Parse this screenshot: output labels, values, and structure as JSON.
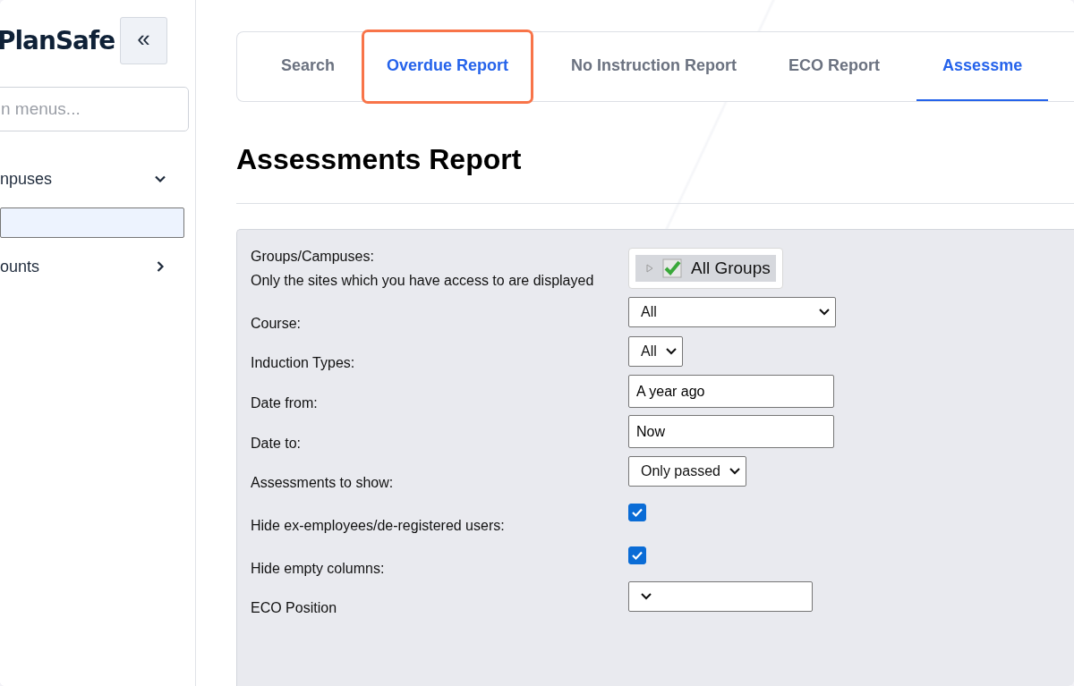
{
  "sidebar": {
    "logo": "PlanSafe",
    "collapse_label": "«",
    "search": {
      "placeholder": "n menus..."
    },
    "items": [
      {
        "label": "npuses",
        "expanded": true,
        "selected": false
      },
      {
        "selected": true
      },
      {
        "label": "ounts",
        "expanded": false,
        "selected": false
      }
    ]
  },
  "tabs": [
    {
      "label": "Search",
      "selected": false,
      "highlighted": false
    },
    {
      "label": "Overdue Report",
      "selected": false,
      "highlighted": true
    },
    {
      "label": "No Instruction Report",
      "selected": false,
      "highlighted": false
    },
    {
      "label": "ECO Report",
      "selected": false,
      "highlighted": false
    },
    {
      "label": "Assessme",
      "selected": true,
      "highlighted": false
    }
  ],
  "heading": "Assessments Report",
  "form": [
    {
      "kind": "tree",
      "label": "Groups/Campuses:",
      "note": "Only the sites which you have access to are displayed",
      "value": "All Groups",
      "checked": true
    },
    {
      "kind": "select",
      "label": "Course:",
      "value": "All"
    },
    {
      "kind": "select",
      "label": "Induction Types:",
      "value": "All"
    },
    {
      "kind": "text",
      "label": "Date from:",
      "value": "A year ago"
    },
    {
      "kind": "text",
      "label": "Date to:",
      "value": "Now"
    },
    {
      "kind": "select",
      "label": "Assessments to show:",
      "value": "Only passed"
    },
    {
      "kind": "checkbox",
      "label": "Hide ex-employees/de-registered users:",
      "checked": true
    },
    {
      "kind": "checkbox",
      "label": "Hide empty columns:",
      "checked": true
    },
    {
      "kind": "select",
      "label": "ECO Position"
    }
  ]
}
